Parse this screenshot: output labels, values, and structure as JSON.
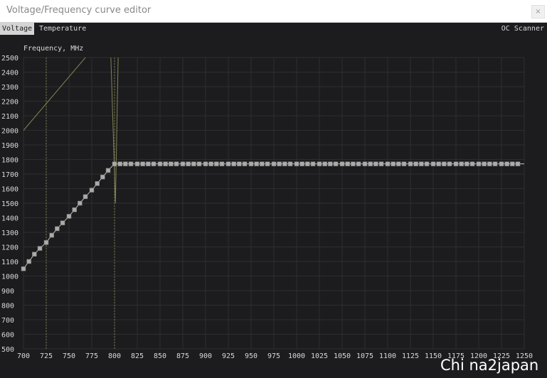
{
  "window": {
    "title": "Voltage/Frequency curve editor",
    "close_label": "×"
  },
  "tabs": [
    {
      "label": "Voltage"
    },
    {
      "label": "Temperature"
    }
  ],
  "oc_scanner_label": "OC Scanner",
  "watermark": "Chi na2japan",
  "colors": {
    "background": "#1c1c1e",
    "grid": "#2e2e30",
    "curve_marker": "#aaaaaa",
    "curve_line": "#c8c8a0",
    "accent_line": "#9c9c60",
    "text": "#d8d8d8"
  },
  "chart_data": {
    "type": "line",
    "ylabel": "Frequency, MHz",
    "xlabel": "",
    "xlim": [
      700,
      1250
    ],
    "ylim": [
      500,
      2500
    ],
    "x_ticks": [
      700,
      725,
      750,
      775,
      800,
      825,
      850,
      875,
      900,
      925,
      950,
      975,
      1000,
      1025,
      1050,
      1075,
      1100,
      1125,
      1150,
      1175,
      1200,
      1225,
      1250
    ],
    "y_ticks": [
      500,
      600,
      700,
      800,
      900,
      1000,
      1100,
      1200,
      1300,
      1400,
      1500,
      1600,
      1700,
      1800,
      1900,
      2000,
      2100,
      2200,
      2300,
      2400,
      2500
    ],
    "grid": true,
    "series": [
      {
        "x": [
          700,
          706,
          712,
          718,
          725,
          731,
          737,
          743,
          750,
          756,
          762,
          768,
          775,
          781,
          787,
          793,
          800,
          806,
          812,
          818,
          825,
          831,
          837,
          843,
          850,
          856,
          862,
          868,
          875,
          881,
          887,
          893,
          900,
          906,
          912,
          918,
          925,
          931,
          937,
          943,
          950,
          956,
          962,
          968,
          975,
          981,
          987,
          993,
          1000,
          1006,
          1012,
          1018,
          1025,
          1031,
          1037,
          1043,
          1050,
          1056,
          1062,
          1068,
          1075,
          1081,
          1087,
          1093,
          1100,
          1106,
          1112,
          1118,
          1125,
          1131,
          1137,
          1143,
          1150,
          1156,
          1162,
          1168,
          1175,
          1181,
          1187,
          1193,
          1200,
          1206,
          1212,
          1218,
          1225,
          1231,
          1237,
          1243
        ],
        "y": [
          1050,
          1100,
          1150,
          1190,
          1230,
          1280,
          1325,
          1365,
          1410,
          1455,
          1500,
          1545,
          1590,
          1635,
          1680,
          1725,
          1770,
          1770,
          1770,
          1770,
          1770,
          1770,
          1770,
          1770,
          1770,
          1770,
          1770,
          1770,
          1770,
          1770,
          1770,
          1770,
          1770,
          1770,
          1770,
          1770,
          1770,
          1770,
          1770,
          1770,
          1770,
          1770,
          1770,
          1770,
          1770,
          1770,
          1770,
          1770,
          1770,
          1770,
          1770,
          1770,
          1770,
          1770,
          1770,
          1770,
          1770,
          1770,
          1770,
          1770,
          1770,
          1770,
          1770,
          1770,
          1770,
          1770,
          1770,
          1770,
          1770,
          1770,
          1770,
          1770,
          1770,
          1770,
          1770,
          1770,
          1770,
          1770,
          1770,
          1770,
          1770,
          1770,
          1770,
          1770,
          1770,
          1770,
          1770,
          1770
        ]
      }
    ],
    "reference_x": [
      725,
      800
    ]
  }
}
